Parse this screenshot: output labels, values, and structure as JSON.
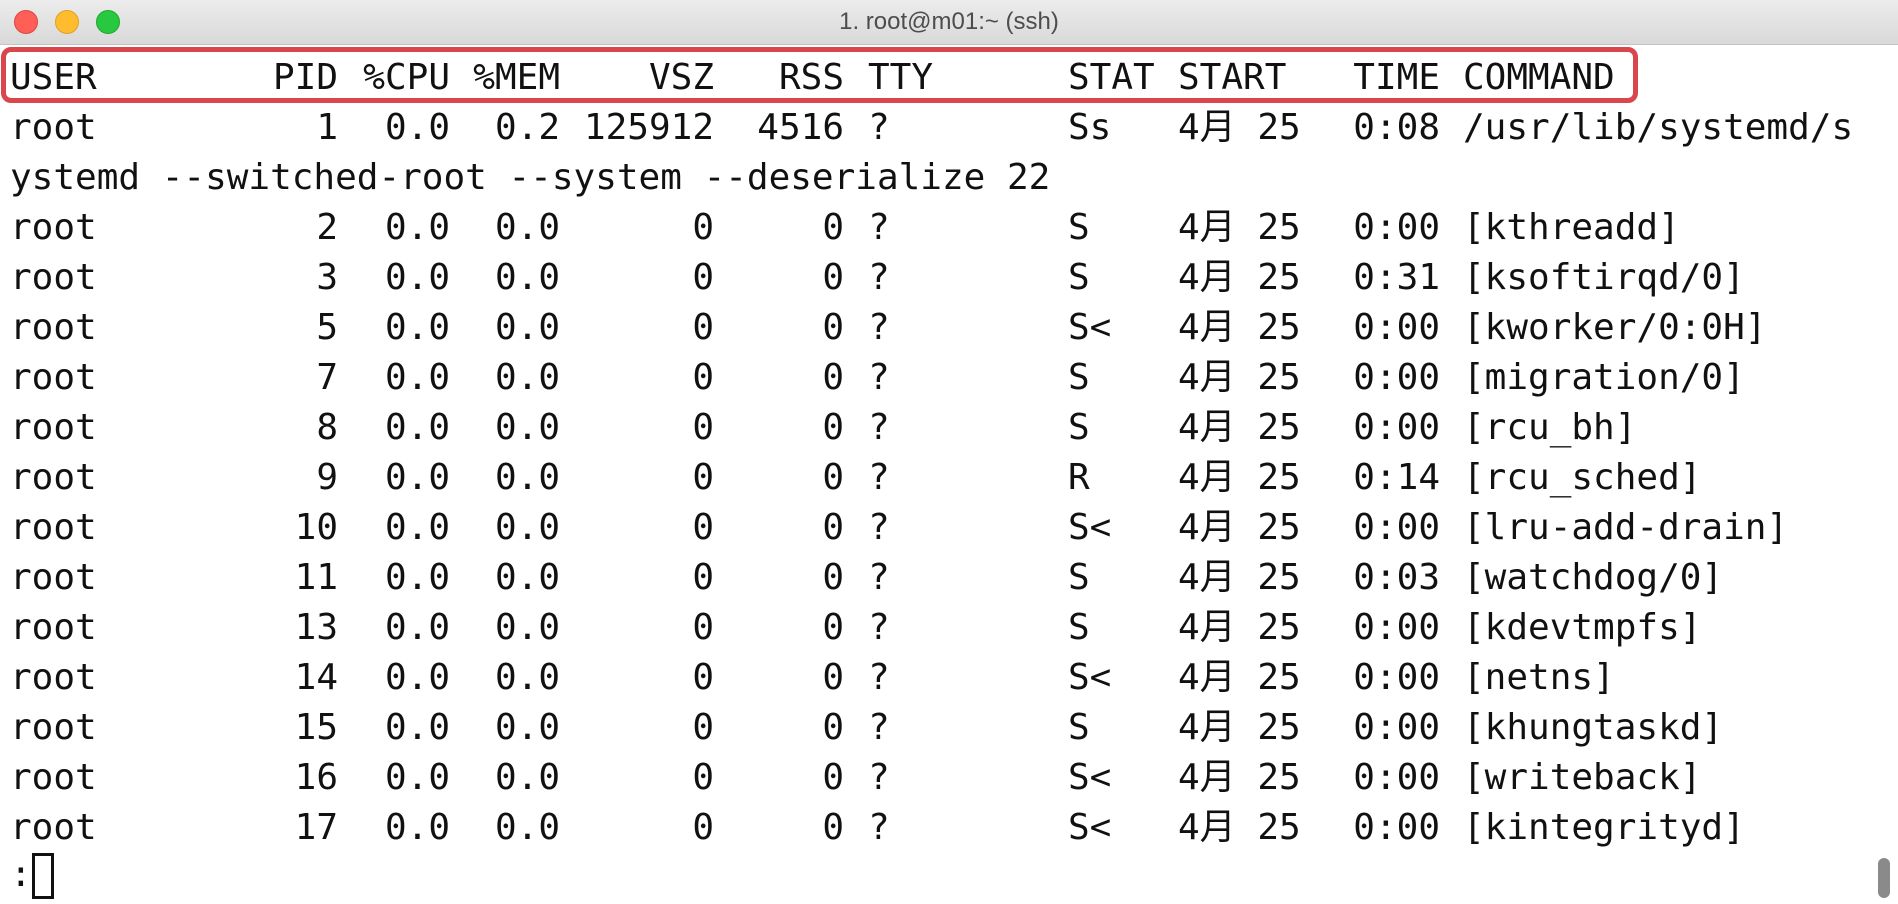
{
  "window": {
    "title": "1. root@m01:~ (ssh)"
  },
  "header": {
    "user": "USER",
    "pid": "PID",
    "cpu": "%CPU",
    "mem": "%MEM",
    "vsz": "VSZ",
    "rss": "RSS",
    "tty": "TTY",
    "stat": "STAT",
    "start": "START",
    "time": "TIME",
    "command": "COMMAND"
  },
  "rows": [
    {
      "user": "root",
      "pid": "1",
      "cpu": "0.0",
      "mem": "0.2",
      "vsz": "125912",
      "rss": "4516",
      "tty": "?",
      "stat": "Ss",
      "start": "4月 25",
      "time": "0:08",
      "command": "/usr/lib/systemd/s"
    },
    {
      "user": "root",
      "pid": "2",
      "cpu": "0.0",
      "mem": "0.0",
      "vsz": "0",
      "rss": "0",
      "tty": "?",
      "stat": "S",
      "start": "4月 25",
      "time": "0:00",
      "command": "[kthreadd]"
    },
    {
      "user": "root",
      "pid": "3",
      "cpu": "0.0",
      "mem": "0.0",
      "vsz": "0",
      "rss": "0",
      "tty": "?",
      "stat": "S",
      "start": "4月 25",
      "time": "0:31",
      "command": "[ksoftirqd/0]"
    },
    {
      "user": "root",
      "pid": "5",
      "cpu": "0.0",
      "mem": "0.0",
      "vsz": "0",
      "rss": "0",
      "tty": "?",
      "stat": "S<",
      "start": "4月 25",
      "time": "0:00",
      "command": "[kworker/0:0H]"
    },
    {
      "user": "root",
      "pid": "7",
      "cpu": "0.0",
      "mem": "0.0",
      "vsz": "0",
      "rss": "0",
      "tty": "?",
      "stat": "S",
      "start": "4月 25",
      "time": "0:00",
      "command": "[migration/0]"
    },
    {
      "user": "root",
      "pid": "8",
      "cpu": "0.0",
      "mem": "0.0",
      "vsz": "0",
      "rss": "0",
      "tty": "?",
      "stat": "S",
      "start": "4月 25",
      "time": "0:00",
      "command": "[rcu_bh]"
    },
    {
      "user": "root",
      "pid": "9",
      "cpu": "0.0",
      "mem": "0.0",
      "vsz": "0",
      "rss": "0",
      "tty": "?",
      "stat": "R",
      "start": "4月 25",
      "time": "0:14",
      "command": "[rcu_sched]"
    },
    {
      "user": "root",
      "pid": "10",
      "cpu": "0.0",
      "mem": "0.0",
      "vsz": "0",
      "rss": "0",
      "tty": "?",
      "stat": "S<",
      "start": "4月 25",
      "time": "0:00",
      "command": "[lru-add-drain]"
    },
    {
      "user": "root",
      "pid": "11",
      "cpu": "0.0",
      "mem": "0.0",
      "vsz": "0",
      "rss": "0",
      "tty": "?",
      "stat": "S",
      "start": "4月 25",
      "time": "0:03",
      "command": "[watchdog/0]"
    },
    {
      "user": "root",
      "pid": "13",
      "cpu": "0.0",
      "mem": "0.0",
      "vsz": "0",
      "rss": "0",
      "tty": "?",
      "stat": "S",
      "start": "4月 25",
      "time": "0:00",
      "command": "[kdevtmpfs]"
    },
    {
      "user": "root",
      "pid": "14",
      "cpu": "0.0",
      "mem": "0.0",
      "vsz": "0",
      "rss": "0",
      "tty": "?",
      "stat": "S<",
      "start": "4月 25",
      "time": "0:00",
      "command": "[netns]"
    },
    {
      "user": "root",
      "pid": "15",
      "cpu": "0.0",
      "mem": "0.0",
      "vsz": "0",
      "rss": "0",
      "tty": "?",
      "stat": "S",
      "start": "4月 25",
      "time": "0:00",
      "command": "[khungtaskd]"
    },
    {
      "user": "root",
      "pid": "16",
      "cpu": "0.0",
      "mem": "0.0",
      "vsz": "0",
      "rss": "0",
      "tty": "?",
      "stat": "S<",
      "start": "4月 25",
      "time": "0:00",
      "command": "[writeback]"
    },
    {
      "user": "root",
      "pid": "17",
      "cpu": "0.0",
      "mem": "0.0",
      "vsz": "0",
      "rss": "0",
      "tty": "?",
      "stat": "S<",
      "start": "4月 25",
      "time": "0:00",
      "command": "[kintegrityd]"
    }
  ],
  "wrapped_line": "ystemd --switched-root --system --deserialize 22",
  "prompt": ":",
  "colors": {
    "highlight_border": "#d9464b",
    "close": "#fe5f57",
    "minimize": "#febc2e",
    "zoom": "#28c840"
  }
}
